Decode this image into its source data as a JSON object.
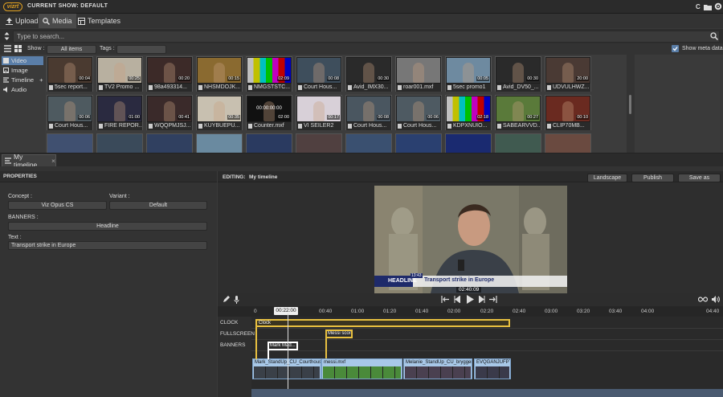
{
  "app": {
    "logo": "vizrt",
    "current_show": "CURRENT SHOW: DEFAULT",
    "top_right_letter": "C"
  },
  "tabs": [
    {
      "label": "Upload",
      "icon": "upload-icon"
    },
    {
      "label": "Media",
      "icon": "search-icon"
    },
    {
      "label": "Templates",
      "icon": "templates-icon"
    }
  ],
  "search": {
    "placeholder": "Type to search..."
  },
  "filter": {
    "show_label": "Show :",
    "show_value": "All items",
    "tags_label": "Tags :",
    "tags_value": "",
    "show_meta_label": "Show meta data",
    "show_meta_checked": true
  },
  "media_types": [
    "Video",
    "Image",
    "Timeline",
    "Audio"
  ],
  "media_items": [
    {
      "name": "5sec report...",
      "duration": "00:04",
      "tone": "#4a3a30"
    },
    {
      "name": "TV2 Promo ...",
      "duration": "00:25",
      "tone": "#b8b0a0"
    },
    {
      "name": "98a493314...",
      "duration": "00:20",
      "tone": "#3c2a28"
    },
    {
      "name": "NHSMDOJK...",
      "duration": "00:15",
      "tone": "#8a6a30"
    },
    {
      "name": "NMGSTSTC...",
      "duration": "02:09",
      "tone": "bars"
    },
    {
      "name": "Court Hous...",
      "duration": "00:08",
      "tone": "#3e4e5c"
    },
    {
      "name": "Avid_IMX30...",
      "duration": "00:30",
      "tone": "#2a2a2a"
    },
    {
      "name": "roar001.mxf",
      "duration": "",
      "tone": "#777"
    },
    {
      "name": "5sec promo1",
      "duration": "00:05",
      "tone": "#6e8aa0"
    },
    {
      "name": "Avid_DV50_...",
      "duration": "00:30",
      "tone": "#2a2a2a"
    },
    {
      "name": "UDVULHWZ...",
      "duration": "20:00",
      "tone": "#4a3a34"
    },
    {
      "name": "Court Hous...",
      "duration": "00:06",
      "tone": "#4e5a60"
    },
    {
      "name": "FIRE REPOR...",
      "duration": "01:00",
      "tone": "#2a2a40"
    },
    {
      "name": "WQQPMJSJ...",
      "duration": "00:41",
      "tone": "#3a2a2a"
    },
    {
      "name": "KUYBUEPU...",
      "duration": "00:35",
      "tone": "#c8c0b0"
    },
    {
      "name": "Counter.mxf",
      "duration": "02:00",
      "tone": "#111",
      "overlay": "00:00:00:00"
    },
    {
      "name": "VI SEILER2",
      "duration": "00:17",
      "tone": "#d8d0d8"
    },
    {
      "name": "Court Hous...",
      "duration": "00:08",
      "tone": "#4a5660"
    },
    {
      "name": "Court Hous...",
      "duration": "00:06",
      "tone": "#4e5a62"
    },
    {
      "name": "KDPXNUIO...",
      "duration": "02:18",
      "tone": "bars"
    },
    {
      "name": "SABEARVVD...",
      "duration": "00:27",
      "tone": "#5a7a3a"
    },
    {
      "name": "CLIP70MB...",
      "duration": "00:10",
      "tone": "#6a2a20"
    }
  ],
  "timeline_tab": "My timeline",
  "properties": {
    "heading": "PROPERTIES",
    "concept_label": "Concept :",
    "concept_value": "Viz Opus CS",
    "variant_label": "Variant :",
    "variant_value": "Default",
    "banners_label": "BANNERS :",
    "banners_value": "Headline",
    "text_label": "Text :",
    "text_value": "Transport strike in Europe"
  },
  "editor": {
    "editing_label": "EDITING:",
    "editing_value": "My timeline",
    "orientation": "Landscape",
    "publish": "Publish",
    "save_as": "Save as",
    "headline": "HEADLINE",
    "clock": "13:43",
    "lower_third": "Transport strike in Europe",
    "timecode": "02:40:09"
  },
  "ruler": {
    "current": "00:22:00",
    "ticks": [
      "0",
      "00:40",
      "01:00",
      "01:20",
      "01:40",
      "02:00",
      "02:20",
      "02:40",
      "03:00",
      "03:20",
      "03:40",
      "04:00",
      "04:40"
    ]
  },
  "tracks": {
    "labels": [
      "CLOCK",
      "FULLSCREEN",
      "BANNERS"
    ],
    "clock_block": "Clock",
    "fullscreen_block": "Messi scores",
    "banner_block": "Mark Mad...",
    "clips": [
      "Mark_StandUp_CU_Courthous...",
      "messi.mxf",
      "Melanie_StandUp_CU_bryggen...",
      "EVQGANJUFPT..."
    ]
  },
  "colors": {
    "accent": "#5a7ea8",
    "track_highlight": "#e8c040",
    "clip_bg": "#a8c8e8"
  }
}
